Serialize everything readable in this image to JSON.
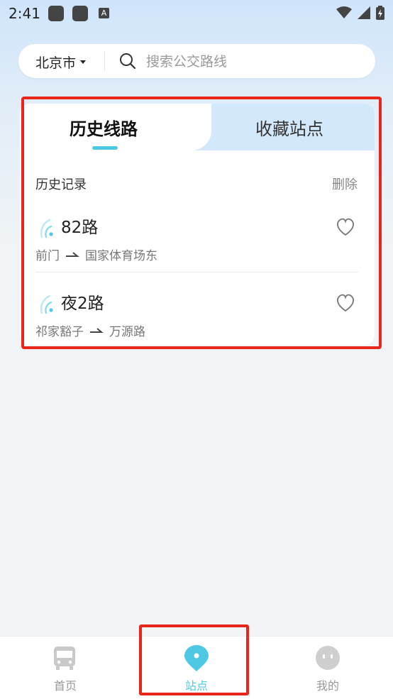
{
  "status_bar": {
    "time": "2:41",
    "a_icon": "A"
  },
  "search": {
    "city": "北京市",
    "placeholder": "搜索公交路线"
  },
  "tabs": [
    {
      "label": "历史线路",
      "active": true
    },
    {
      "label": "收藏站点",
      "active": false
    }
  ],
  "history": {
    "title": "历史记录",
    "delete_label": "删除",
    "items": [
      {
        "name": "82路",
        "from": "前门",
        "to": "国家体育场东"
      },
      {
        "name": "夜2路",
        "from": "祁家豁子",
        "to": "万源路"
      }
    ]
  },
  "bottom_nav": {
    "items": [
      {
        "label": "首页",
        "icon": "bus-icon"
      },
      {
        "label": "站点",
        "icon": "location-pin-icon",
        "active": true
      },
      {
        "label": "我的",
        "icon": "profile-icon"
      }
    ]
  },
  "colors": {
    "accent": "#4fc9e3",
    "highlight": "#e8261c",
    "tab_inactive_bg": "#d3e8fb"
  }
}
